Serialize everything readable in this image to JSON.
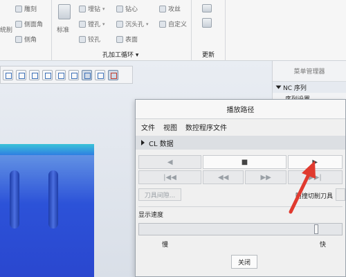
{
  "ribbon": {
    "col1": [
      "雕刻",
      "侧面角",
      "侧角"
    ],
    "col1_left": "统削",
    "standard_label": "标准",
    "col3": [
      "埋钻",
      "镗孔",
      "铰孔"
    ],
    "col4": [
      "钻心",
      "沉头孔",
      "表面"
    ],
    "col5": [
      "攻丝",
      "自定义"
    ],
    "group_hole": "孔加工循环",
    "group_update": "更新"
  },
  "tree": {
    "header": "菜单管理器",
    "nc_sequence": "NC 序列",
    "seq_item": "序列设置"
  },
  "dialog": {
    "title": "播放路径",
    "menu": {
      "file": "文件",
      "view": "视图",
      "nc_file": "数控程序文件"
    },
    "cl_data": "CL 数据",
    "controls_row1": [
      "◀",
      "■",
      "▶"
    ],
    "controls_row2": [
      "|◀◀",
      "◀◀",
      "▶▶",
      "▶▶|"
    ],
    "tool_clearance": "刀具间隙...",
    "gouge_check": "防撞切削刀具",
    "display_speed": "显示速度",
    "speed_value": 0.88,
    "slow": "慢",
    "fast": "快",
    "close": "关闭"
  },
  "colors": {
    "annotation_arrow": "#e03a2f",
    "part_blue": "#2c52d8"
  }
}
